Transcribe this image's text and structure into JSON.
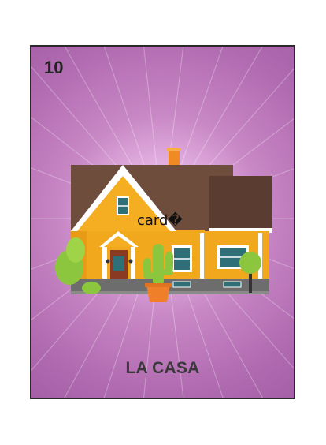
{
  "card": {
    "number": "10",
    "title": "LA CASA",
    "image_alt_text": "card�",
    "illustration": "house-with-cactus",
    "colors": {
      "border": "#2a2a2a",
      "background": "#b06ab0",
      "title": "#3a3a3a",
      "number": "#222222",
      "wall": "#f2a81d",
      "roof": "#6b4a3a",
      "trim": "#ffffff",
      "cactus": "#8cc63f"
    }
  }
}
